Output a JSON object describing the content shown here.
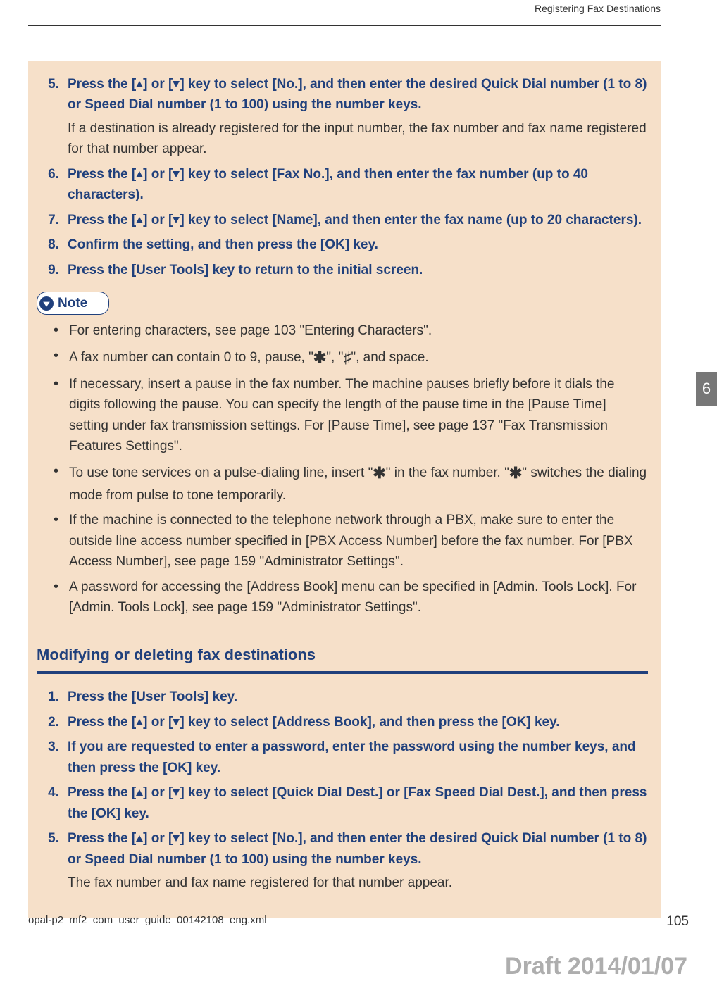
{
  "running_head": "Registering Fax Destinations",
  "side_tab": "6",
  "section1": {
    "steps": [
      {
        "n": "5.",
        "bold_pre": "Press the [",
        "bold_mid1": "] or [",
        "bold_post": "] key to select [No.], and then enter the desired Quick Dial number (1 to 8) or Speed Dial number (1 to 100) using the number keys.",
        "sub": "If a destination is already registered for the input number, the fax number and fax name registered for that number appear."
      },
      {
        "n": "6.",
        "bold_pre": "Press the [",
        "bold_mid1": "] or [",
        "bold_post": "] key to select [Fax No.], and then enter the fax number (up to 40 characters)."
      },
      {
        "n": "7.",
        "bold_pre": "Press the [",
        "bold_mid1": "] or [",
        "bold_post": "] key to select [Name], and then enter the fax name (up to 20 characters)."
      },
      {
        "n": "8.",
        "plain": "Confirm the setting, and then press the [OK] key."
      },
      {
        "n": "9.",
        "plain": "Press the [User Tools] key to return to the initial screen."
      }
    ]
  },
  "note_label": "Note",
  "notes": [
    {
      "text": "For entering characters, see page 103 \"Entering Characters\"."
    },
    {
      "pre": "A fax number can contain 0 to 9, pause, \"",
      "star1": true,
      "mid": "\", \"",
      "hash": true,
      "post": "\", and space."
    },
    {
      "text": "If necessary, insert a pause in the fax number. The machine pauses briefly before it dials the digits following the pause. You can specify the length of the pause time in the [Pause Time] setting under fax transmission settings. For [Pause Time], see page 137 \"Fax Transmission Features Settings\"."
    },
    {
      "pre": "To use tone services on a pulse-dialing line, insert \"",
      "star1": true,
      "mid": "\" in the fax number. \"",
      "star2": true,
      "post": "\" switches the dialing mode from pulse to tone temporarily."
    },
    {
      "text": "If the machine is connected to the telephone network through a PBX, make sure to enter the outside line access number specified in [PBX Access Number] before the fax number. For [PBX Access Number], see page 159 \"Administrator Settings\"."
    },
    {
      "text": "A password for accessing the [Address Book] menu can be specified in [Admin. Tools Lock]. For [Admin. Tools Lock], see page 159 \"Administrator Settings\"."
    }
  ],
  "section2": {
    "heading": "Modifying or deleting fax destinations",
    "steps": [
      {
        "n": "1.",
        "plain": "Press the [User Tools] key."
      },
      {
        "n": "2.",
        "bold_pre": "Press the [",
        "bold_mid1": "] or [",
        "bold_post": "] key to select [Address Book], and then press the [OK] key."
      },
      {
        "n": "3.",
        "plain": "If you are requested to enter a password, enter the password using the number keys, and then press the [OK] key."
      },
      {
        "n": "4.",
        "bold_pre": "Press the [",
        "bold_mid1": "] or [",
        "bold_post": "] key to select [Quick Dial Dest.] or [Fax Speed Dial Dest.], and then press the [OK] key."
      },
      {
        "n": "5.",
        "bold_pre": "Press the [",
        "bold_mid1": "] or [",
        "bold_post": "] key to select [No.], and then enter the desired Quick Dial number (1 to 8) or Speed Dial number (1 to 100) using the number keys.",
        "sub": "The fax number and fax name registered for that number appear."
      }
    ]
  },
  "footer_left": "opal-p2_mf2_com_user_guide_00142108_eng.xml",
  "footer_right": "105",
  "draft": "Draft 2014/01/07",
  "glyphs": {
    "star": "✱",
    "hash": "♯"
  }
}
